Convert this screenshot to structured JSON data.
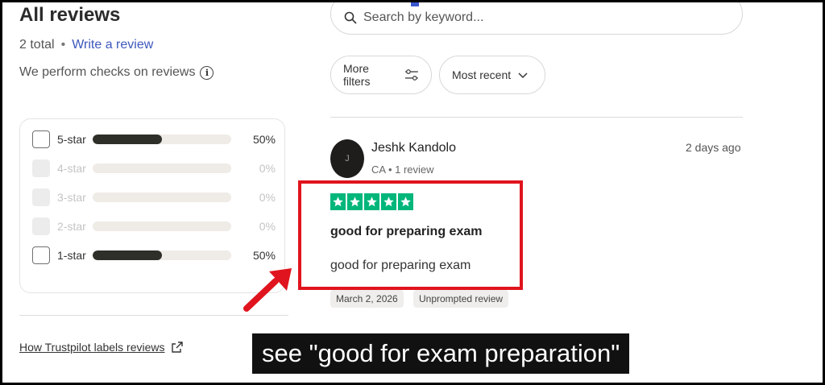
{
  "header": {
    "title": "All reviews",
    "total": "2 total",
    "separator": "•",
    "write_review": "Write a review",
    "checks_note": "We perform checks on reviews",
    "info_glyph": "i"
  },
  "search": {
    "placeholder": "Search by keyword..."
  },
  "filters": {
    "more_filters": "More filters",
    "sort_label": "Most recent"
  },
  "distribution": [
    {
      "label": "5-star",
      "percent": "50%",
      "fill": 0.5,
      "enabled": true
    },
    {
      "label": "4-star",
      "percent": "0%",
      "fill": 0,
      "enabled": false
    },
    {
      "label": "3-star",
      "percent": "0%",
      "fill": 0,
      "enabled": false
    },
    {
      "label": "2-star",
      "percent": "0%",
      "fill": 0,
      "enabled": false
    },
    {
      "label": "1-star",
      "percent": "50%",
      "fill": 0.5,
      "enabled": true
    }
  ],
  "labels_link": "How Trustpilot labels reviews",
  "review": {
    "avatar_initial": "J",
    "name": "Jeshk Kandolo",
    "meta": "CA • 1 review",
    "date_relative": "2 days ago",
    "rating": 5,
    "title": "good for preparing exam",
    "body": "good for preparing exam",
    "tags": [
      "March 2, 2026",
      "Unprompted review"
    ]
  },
  "caption": "see \"good for exam preparation\"",
  "colors": {
    "star_green": "#00b67a",
    "link_blue": "#3c57bc",
    "highlight_red": "#e0141e",
    "bar_fill": "#2f2f2a"
  }
}
